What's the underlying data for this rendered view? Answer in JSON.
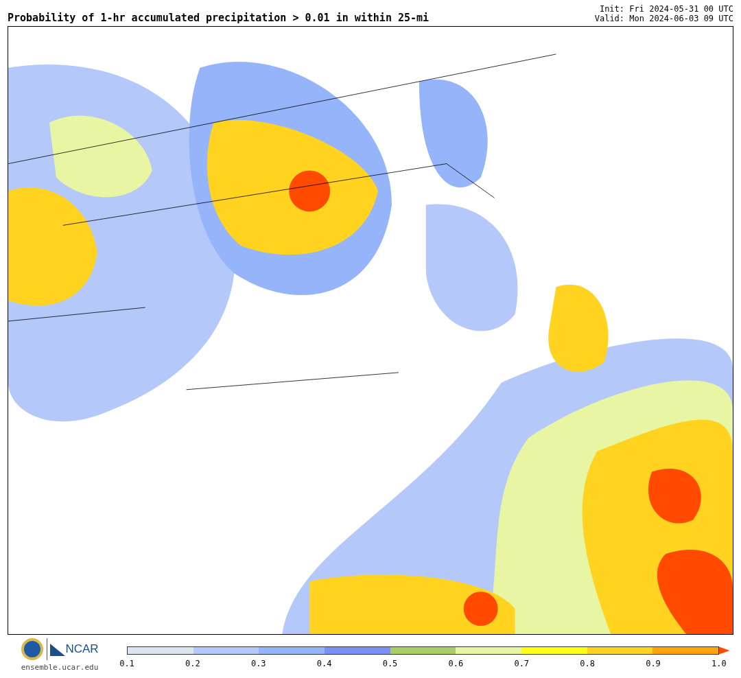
{
  "title": "Probability of 1-hr accumulated precipitation > 0.01 in within 25-mi",
  "init": "Init: Fri 2024-05-31 00 UTC",
  "valid": "Valid: Mon 2024-06-03 09 UTC",
  "logo": {
    "name": "NCAR",
    "url": "ensemble.ucar.edu"
  },
  "colorbar": {
    "bins": [
      {
        "kind": "segment",
        "color": "#dbe4ef"
      },
      {
        "kind": "segment",
        "color": "#b4c8fa"
      },
      {
        "kind": "segment",
        "color": "#96b4fa"
      },
      {
        "kind": "segment",
        "color": "#7b90f5"
      },
      {
        "kind": "segment",
        "color": "#a9cd68"
      },
      {
        "kind": "segment",
        "color": "#e8f5a3"
      },
      {
        "kind": "segment",
        "color": "#ffff14"
      },
      {
        "kind": "segment",
        "color": "#ffd320"
      },
      {
        "kind": "segment",
        "color": "#ffa50a"
      },
      {
        "kind": "arrow",
        "color": "#ff4a00"
      }
    ],
    "ticks": [
      "0.1",
      "0.2",
      "0.3",
      "0.4",
      "0.5",
      "0.6",
      "0.7",
      "0.8",
      "0.9",
      "1.0"
    ]
  }
}
